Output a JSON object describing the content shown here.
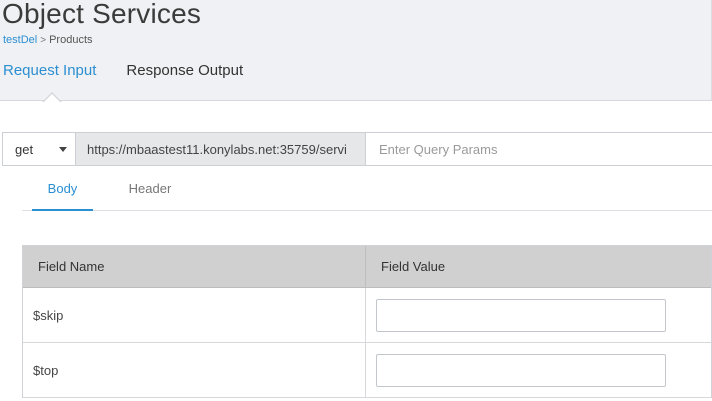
{
  "page_title": "Object Services",
  "breadcrumb": {
    "link": "testDel",
    "separator": ">",
    "current": "Products"
  },
  "main_tabs": [
    {
      "label": "Request Input",
      "active": true
    },
    {
      "label": "Response Output",
      "active": false
    }
  ],
  "request": {
    "method": "get",
    "url": "https://mbaastest11.konylabs.net:35759/servi",
    "query_placeholder": "Enter Query Params"
  },
  "sub_tabs": [
    {
      "label": "Body",
      "active": true
    },
    {
      "label": "Header",
      "active": false
    }
  ],
  "grid": {
    "headers": [
      "Field Name",
      "Field Value"
    ],
    "rows": [
      {
        "name": "$skip",
        "value": ""
      },
      {
        "name": "$top",
        "value": ""
      }
    ]
  },
  "colors": {
    "accent": "#2b8fd2",
    "header_band": "#f0f1f4",
    "grid_header": "#d0d0d0"
  }
}
